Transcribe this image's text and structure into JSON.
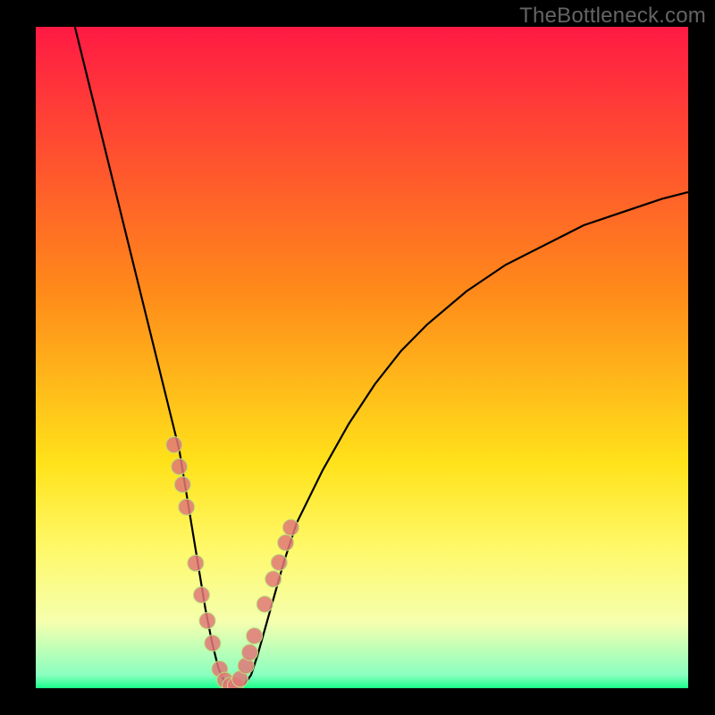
{
  "watermark": "TheBottleneck.com",
  "colors": {
    "bg_black": "#000000",
    "grad_red": "#ff1a44",
    "grad_orange": "#ff8a1a",
    "grad_yellow": "#ffe21a",
    "grad_lightyellow": "#fff96a",
    "grad_paleyellow": "#f5ffae",
    "grad_green": "#1aff8a",
    "curve": "#000000",
    "marker_fill": "#e07878",
    "marker_stroke": "#b9e07a",
    "band_yellow": "#ffff8a",
    "band_green": "#8aff8a",
    "band_deep_green": "#1aff4a"
  },
  "chart_data": {
    "type": "line",
    "title": "",
    "xlabel": "",
    "ylabel": "",
    "xlim": [
      0,
      100
    ],
    "ylim": [
      0,
      100
    ],
    "grid": false,
    "series": [
      {
        "name": "bottleneck-curve",
        "x": [
          6,
          8,
          10,
          12,
          14,
          16,
          18,
          20,
          21,
          22,
          23,
          24,
          25,
          26,
          27,
          28,
          29,
          30,
          31,
          32,
          33,
          34,
          36,
          38,
          40,
          44,
          48,
          52,
          56,
          60,
          66,
          72,
          78,
          84,
          90,
          96,
          100
        ],
        "values": [
          100,
          92,
          84,
          76,
          68,
          60,
          52,
          44,
          40,
          36,
          30,
          24,
          18,
          12,
          7,
          3,
          0.8,
          0.2,
          0.2,
          0.6,
          2,
          5,
          12,
          19,
          25,
          33,
          40,
          46,
          51,
          55,
          60,
          64,
          67,
          70,
          72,
          74,
          75
        ]
      }
    ],
    "markers": {
      "name": "highlighted-points",
      "x": [
        21.2,
        22.0,
        22.5,
        23.1,
        24.5,
        25.4,
        26.3,
        27.1,
        28.2,
        29.0,
        29.8,
        30.6,
        31.3,
        32.2,
        32.8,
        33.5,
        35.1,
        36.4,
        37.3,
        38.3,
        39.1
      ],
      "values": [
        36.8,
        33.5,
        30.8,
        27.4,
        18.9,
        14.1,
        10.2,
        6.8,
        2.9,
        1.2,
        0.4,
        0.4,
        1.4,
        3.4,
        5.4,
        7.9,
        12.7,
        16.5,
        19.0,
        22.0,
        24.3
      ]
    },
    "bands": [
      {
        "name": "pale-band",
        "y0": 20,
        "y1": 28,
        "color": "#ffff8a",
        "alpha": 0.0
      },
      {
        "name": "green-band",
        "y0": 0,
        "y1": 3,
        "color": "#1aff4a",
        "alpha": 0.0
      }
    ]
  }
}
